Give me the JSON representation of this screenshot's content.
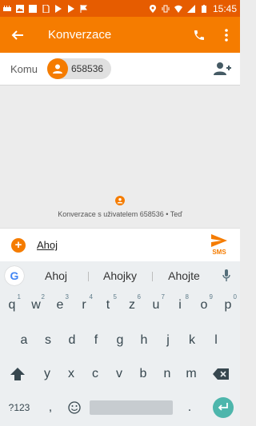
{
  "status_bar": {
    "time": "15:45",
    "left_icons": [
      "storage-icon",
      "image-icon",
      "square-icon",
      "sim-icon",
      "play-store-icon",
      "play-store-icon",
      "flag-icon"
    ],
    "right_icons": [
      "location-icon",
      "vibrate-icon",
      "wifi-icon",
      "signal-icon",
      "battery-icon"
    ]
  },
  "app_bar": {
    "title": "Konverzace",
    "back_icon": "arrow-back-icon",
    "call_icon": "phone-icon",
    "menu_icon": "more-vert-icon"
  },
  "recipients": {
    "label": "Komu",
    "chip": "658536",
    "add_icon": "add-person-icon"
  },
  "conversation": {
    "info": "Konverzace s uživatelem 658536 • Teď"
  },
  "compose": {
    "message": "Ahoj",
    "send_label": "SMS"
  },
  "keyboard": {
    "suggestions": [
      "Ahoj",
      "Ahojky",
      "Ahojte"
    ],
    "row1": [
      {
        "k": "q",
        "h": "1"
      },
      {
        "k": "w",
        "h": "2"
      },
      {
        "k": "e",
        "h": "3"
      },
      {
        "k": "r",
        "h": "4"
      },
      {
        "k": "t",
        "h": "5"
      },
      {
        "k": "z",
        "h": "6"
      },
      {
        "k": "u",
        "h": "7"
      },
      {
        "k": "i",
        "h": "8"
      },
      {
        "k": "o",
        "h": "9"
      },
      {
        "k": "p",
        "h": "0"
      }
    ],
    "row2": [
      "a",
      "s",
      "d",
      "f",
      "g",
      "h",
      "j",
      "k",
      "l"
    ],
    "row3": [
      "y",
      "x",
      "c",
      "v",
      "b",
      "n",
      "m"
    ],
    "row4": {
      "symbols": "?123",
      "comma": ",",
      "dot": "."
    }
  },
  "colors": {
    "status": "#e65c00",
    "accent": "#f57c00",
    "enter": "#4db6ac"
  }
}
